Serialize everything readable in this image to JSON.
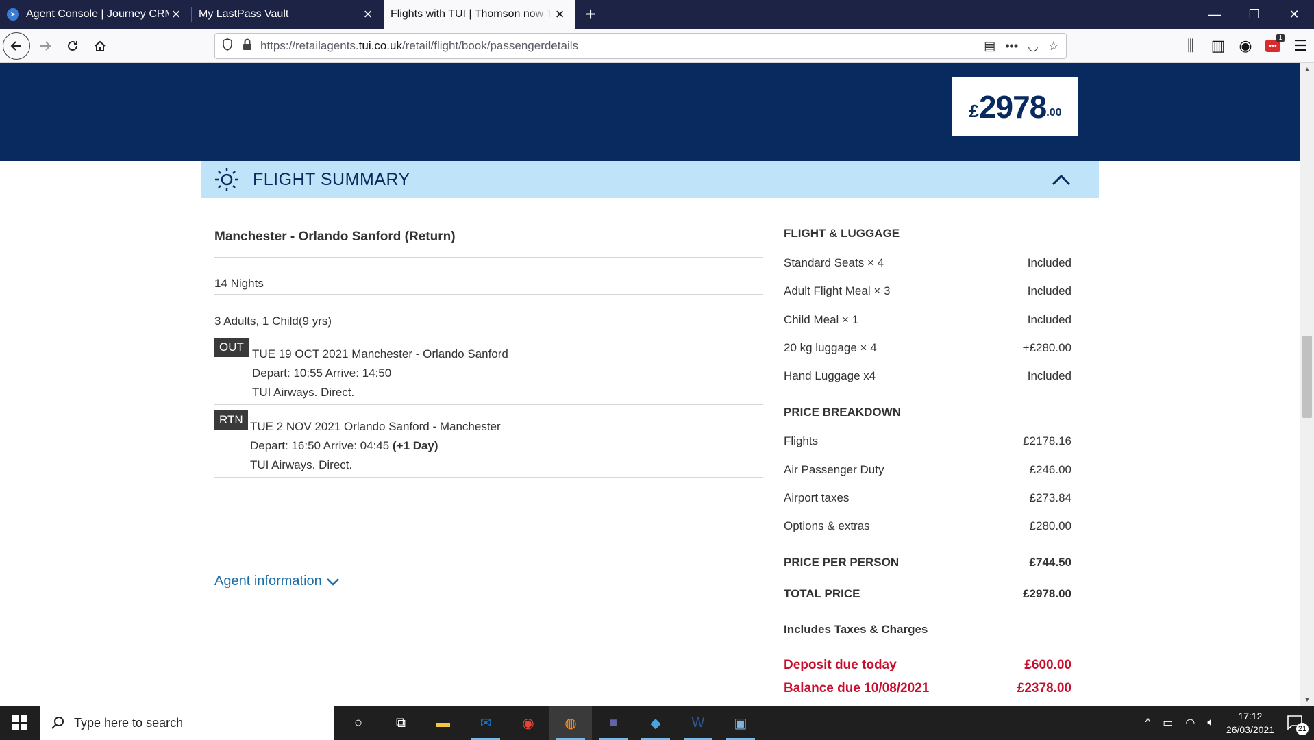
{
  "browser": {
    "tabs": [
      {
        "title": "Agent Console | Journey CRM",
        "icon": "telegram-icon"
      },
      {
        "title": "My LastPass Vault",
        "icon": ""
      },
      {
        "title": "Flights with TUI | Thomson now TUI",
        "icon": ""
      }
    ],
    "new_tab": "+",
    "url_prefix": "https://retailagents.",
    "url_domain": "tui.co.uk",
    "url_path": "/retail/flight/book/passengerdetails",
    "ext_badge": "1"
  },
  "header": {
    "price_currency": "£",
    "price_main": "2978",
    "price_decimal": ".00",
    "banner_color": "#092a5e"
  },
  "summary": {
    "title": "FLIGHT SUMMARY",
    "route": "Manchester - Orlando Sanford (Return)",
    "nights": "14 Nights",
    "passengers": "3 Adults, 1 Child(9 yrs)",
    "outbound": {
      "badge": "OUT",
      "line1": "TUE 19 OCT 2021 Manchester  - Orlando Sanford",
      "line2": "Depart: 10:55 Arrive: 14:50",
      "line3": "TUI Airways. Direct."
    },
    "return": {
      "badge": "RTN",
      "line1": "TUE 2 NOV 2021 Orlando Sanford - Manchester",
      "line2": "Depart: 16:50 Arrive: 04:45",
      "line2_bold": "(+1 Day)",
      "line3": "TUI Airways. Direct."
    },
    "agent_info": "Agent information"
  },
  "pricing": {
    "luggage_head": "FLIGHT & LUGGAGE",
    "luggage": [
      {
        "label": "Standard Seats × 4",
        "value": "Included"
      },
      {
        "label": "Adult Flight Meal × 3",
        "value": "Included"
      },
      {
        "label": "Child Meal × 1",
        "value": "Included"
      },
      {
        "label": "20 kg luggage × 4",
        "value": "+£280.00"
      },
      {
        "label": "Hand Luggage x4",
        "value": "Included"
      }
    ],
    "breakdown_head": "PRICE BREAKDOWN",
    "breakdown": [
      {
        "label": "Flights",
        "value": "£2178.16"
      },
      {
        "label": "Air Passenger Duty",
        "value": "£246.00"
      },
      {
        "label": "Airport taxes",
        "value": "£273.84"
      },
      {
        "label": "Options & extras",
        "value": "£280.00"
      }
    ],
    "per_person_label": "PRICE PER PERSON",
    "per_person_value": "£744.50",
    "total_label": "TOTAL PRICE",
    "total_value": "£2978.00",
    "includes": "Includes Taxes & Charges",
    "deposit_label": "Deposit due today",
    "deposit_value": "£600.00",
    "balance_label": "Balance due 10/08/2021",
    "balance_value": "£2378.00",
    "red_color": "#c8102e"
  },
  "taskbar": {
    "search_placeholder": "Type here to search",
    "time": "17:12",
    "date": "26/03/2021",
    "notif_count": "21"
  }
}
